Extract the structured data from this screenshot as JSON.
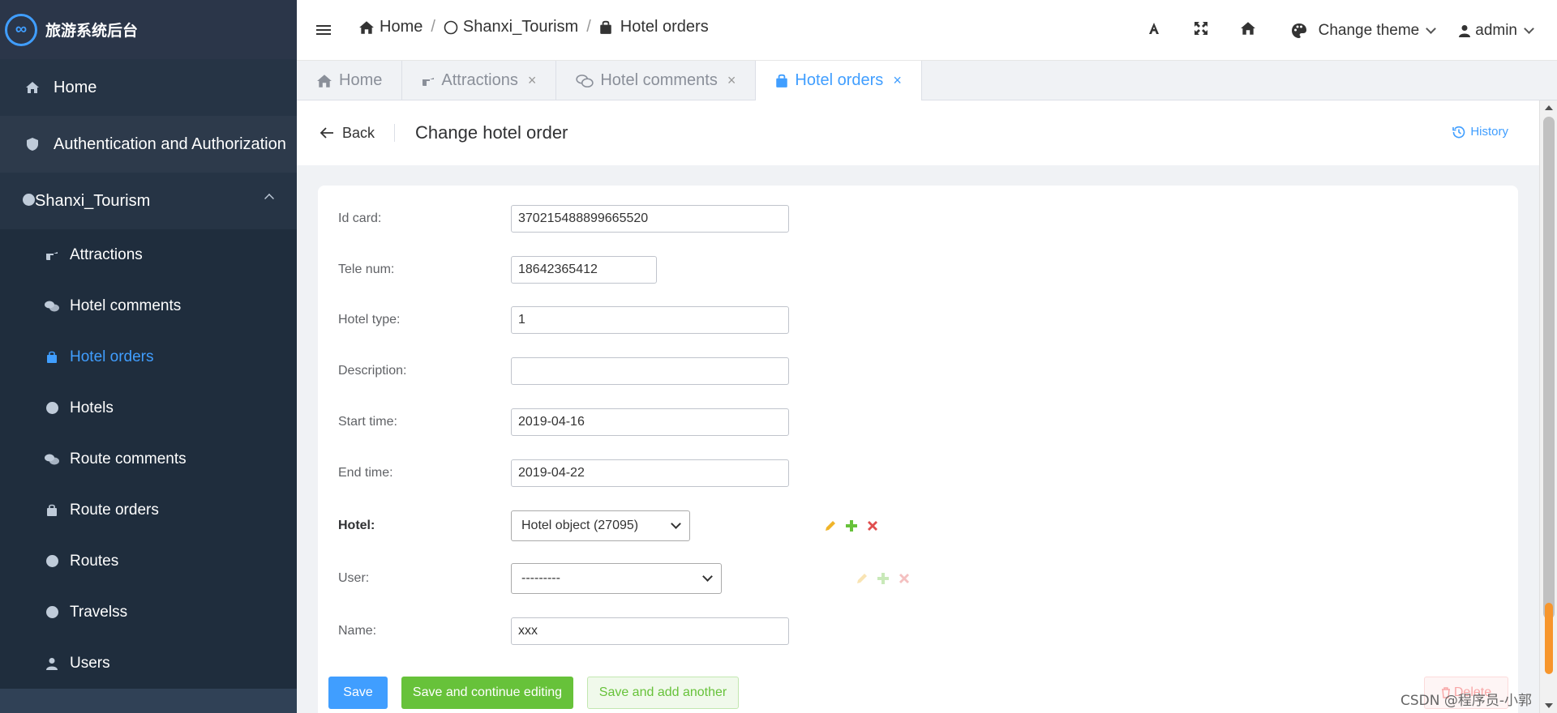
{
  "app": {
    "logo_text": "旅游系统后台",
    "logo_glyph": "∞"
  },
  "sidebar": {
    "items": [
      {
        "label": "Home",
        "icon": "home-icon"
      },
      {
        "label": "Authentication and Authorization",
        "icon": "shield-icon"
      }
    ],
    "group": {
      "label": "Shanxi_Tourism",
      "expanded": true
    },
    "sub_items": [
      {
        "label": "Attractions",
        "icon": "hand-point-icon"
      },
      {
        "label": "Hotel comments",
        "icon": "comments-icon"
      },
      {
        "label": "Hotel orders",
        "icon": "shopping-bag-icon",
        "active": true
      },
      {
        "label": "Hotels",
        "icon": "circle-icon"
      },
      {
        "label": "Route comments",
        "icon": "comments-icon"
      },
      {
        "label": "Route orders",
        "icon": "shopping-bag-icon"
      },
      {
        "label": "Routes",
        "icon": "circle-icon"
      },
      {
        "label": "Travelss",
        "icon": "circle-icon"
      },
      {
        "label": "Users",
        "icon": "user-icon"
      }
    ]
  },
  "header": {
    "breadcrumb": [
      "Home",
      "Shanxi_Tourism",
      "Hotel orders"
    ],
    "theme_label": "Change theme",
    "user_label": "admin"
  },
  "tabs": [
    {
      "label": "Home",
      "icon": "home-icon",
      "closable": false
    },
    {
      "label": "Attractions",
      "icon": "hand-point-icon",
      "closable": true
    },
    {
      "label": "Hotel comments",
      "icon": "comments-icon",
      "closable": true
    },
    {
      "label": "Hotel orders",
      "icon": "shopping-bag-icon",
      "closable": true,
      "active": true
    }
  ],
  "page": {
    "back_label": "Back",
    "title": "Change hotel order",
    "history_label": "History"
  },
  "form": {
    "id_card": {
      "label": "Id card:",
      "value": "370215488899665520"
    },
    "tele_num": {
      "label": "Tele num:",
      "value": "18642365412"
    },
    "hotel_type": {
      "label": "Hotel type:",
      "value": "1"
    },
    "description": {
      "label": "Description:",
      "value": ""
    },
    "start_time": {
      "label": "Start time:",
      "value": "2019-04-16"
    },
    "end_time": {
      "label": "End time:",
      "value": "2019-04-22"
    },
    "hotel": {
      "label": "Hotel:",
      "value": "Hotel object (27095)"
    },
    "user": {
      "label": "User:",
      "value": "---------"
    },
    "name": {
      "label": "Name:",
      "value": "xxx"
    }
  },
  "buttons": {
    "save": "Save",
    "save_continue": "Save and continue editing",
    "save_add": "Save and add another",
    "delete": "Delete"
  },
  "watermark": "CSDN @程序员-小郭",
  "colors": {
    "primary": "#409eff",
    "success": "#67c23a",
    "danger": "#f56c6c",
    "sidebar": "#304156"
  }
}
